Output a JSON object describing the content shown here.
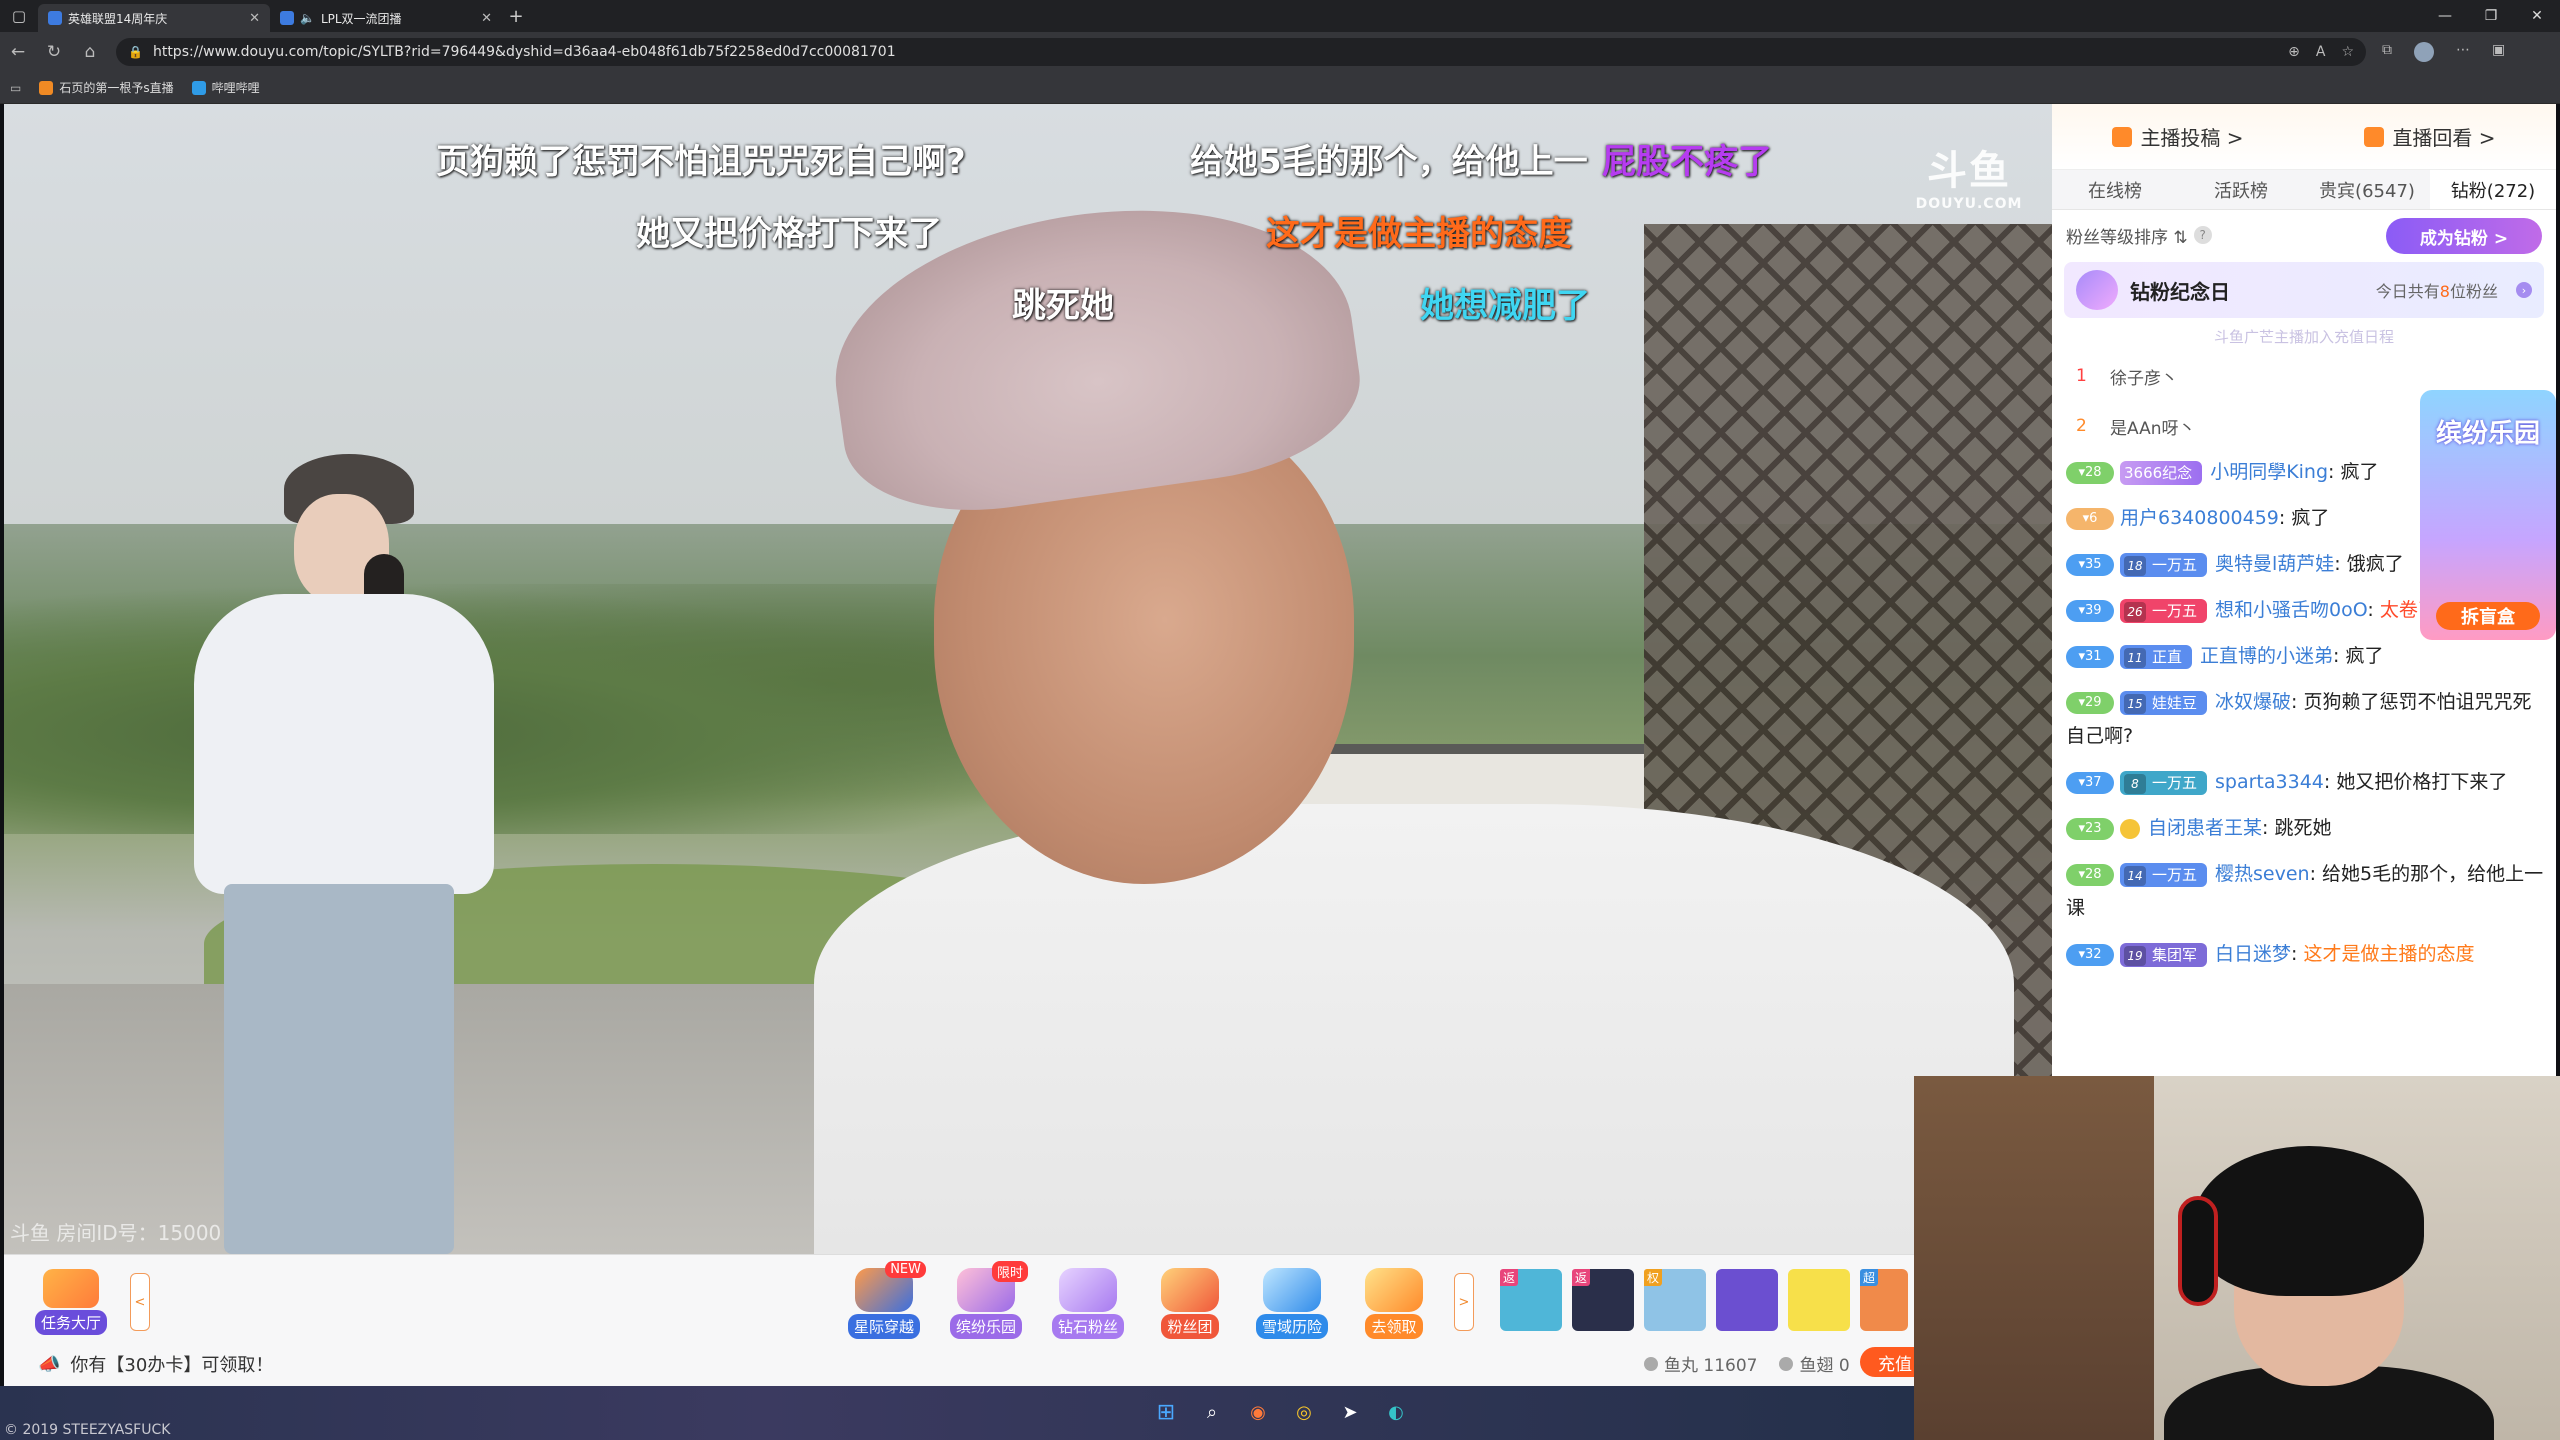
{
  "browser": {
    "tabs": [
      {
        "title": "英雄联盟14周年庆",
        "active": true
      },
      {
        "title": "LPL双一流团播",
        "active": false
      }
    ],
    "url": "https://www.douyu.com/topic/SYLTB?rid=796449&dyshid=d36aa4-eb048f61db75f2258ed0d7cc00081701",
    "bookmarks": [
      "石页的第一根予s直播",
      "哔哩哔哩"
    ]
  },
  "video": {
    "watermark_main": "斗鱼",
    "watermark_sub": "DOUYU.COM",
    "room_number": "斗鱼 房间ID号：15000",
    "danmu": [
      {
        "text": "页狗赖了惩罚不怕诅咒咒死自己啊?",
        "color": "w"
      },
      {
        "text": "给她5毛的那个，给他上一",
        "color": "w"
      },
      {
        "text": "屁股不疼了",
        "color": "p"
      },
      {
        "text": "她又把价格打下来了",
        "color": "w"
      },
      {
        "text": "这才是做主播的态度",
        "color": "o"
      },
      {
        "text": "跳死她",
        "color": "w"
      },
      {
        "text": "她想减肥了",
        "color": "c"
      }
    ]
  },
  "giftbar": {
    "task_hall": "任务大厅",
    "collapse_symbol": "<",
    "expand_symbol": ">",
    "gifts": [
      {
        "label": "星际穿越",
        "badge": "NEW",
        "color": "#3a6fe0"
      },
      {
        "label": "缤纷乐园",
        "badge": "限时",
        "color": "#9b6be8"
      },
      {
        "label": "钻石粉丝",
        "badge": "",
        "color": "#a77af0"
      },
      {
        "label": "粉丝团",
        "badge": "",
        "color": "#f0573a"
      },
      {
        "label": "雪域历险",
        "badge": "",
        "color": "#2f8bea"
      },
      {
        "label": "去领取",
        "badge": "",
        "color": "#ff8a2a"
      }
    ],
    "props": [
      {
        "tag": "返",
        "color": "#4fb6d8"
      },
      {
        "tag": "返",
        "color": "#2a2f4a"
      },
      {
        "tag": "权",
        "color": "#8fc3e6"
      },
      {
        "tag": "",
        "color": "#6b4fd0"
      },
      {
        "tag": "",
        "color": "#f7e04a"
      },
      {
        "tag": "超",
        "color": "#f08a4a"
      }
    ],
    "notice": "你有【30办卡】可领取！",
    "wallet": [
      {
        "label": "鱼丸 11607"
      },
      {
        "label": "鱼翅 0"
      }
    ],
    "recharge": "充值"
  },
  "sidebar": {
    "top_links": [
      "主播投稿 >",
      "直播回看 >"
    ],
    "tabs": [
      {
        "label": "在线榜",
        "active": false
      },
      {
        "label": "活跃榜",
        "active": false
      },
      {
        "label": "贵宾(6547)",
        "active": false
      },
      {
        "label": "钻粉(272)",
        "active": true
      }
    ],
    "sort_label": "粉丝等级排序 ⇅",
    "help": "?",
    "become_diamond": "成为钻粉 >",
    "anniversary": {
      "title": "钻粉纪念日",
      "note_prefix": "今日共有",
      "note_count": "8",
      "note_suffix": "位粉丝",
      "sub": "斗鱼广芒主播加入充值日程"
    },
    "ranks": [
      {
        "no": "1",
        "name": "徐子彦丶"
      },
      {
        "no": "2",
        "name": "是AAn呀丶"
      }
    ],
    "promo": {
      "title": "缤纷乐园",
      "button": "拆盲盒"
    },
    "messages": [
      {
        "lv": "28",
        "lvc": "green",
        "fan_lv": "",
        "fan": "3666纪念",
        "fanc": "fan-special",
        "user": "小明同學King",
        "text": "疯了",
        "tc": ""
      },
      {
        "lv": "6",
        "lvc": "orange",
        "fan_lv": "",
        "fan": "",
        "fanc": "",
        "user": "用户6340800459",
        "text": "疯了",
        "tc": ""
      },
      {
        "lv": "35",
        "lvc": "blue",
        "fan_lv": "18",
        "fan": "一万五",
        "fanc": "fan-blue",
        "user": "奥特曼l葫芦娃",
        "text": "饿疯了",
        "tc": ""
      },
      {
        "lv": "39",
        "lvc": "blue",
        "fan_lv": "26",
        "fan": "一万五",
        "fanc": "fan-red",
        "user": "想和小骚舌吻0oO",
        "text": "太卷了太卷了",
        "tc": "red"
      },
      {
        "lv": "31",
        "lvc": "blue",
        "fan_lv": "11",
        "fan": "正直",
        "fanc": "fan-blue",
        "user": "正直博的小迷弟",
        "text": "疯了",
        "tc": ""
      },
      {
        "lv": "29",
        "lvc": "green",
        "fan_lv": "15",
        "fan": "娃娃豆",
        "fanc": "fan-blue",
        "user": "冰奴爆破",
        "text": "页狗赖了惩罚不怕诅咒咒死自己啊?",
        "tc": ""
      },
      {
        "lv": "37",
        "lvc": "blue",
        "fan_lv": "8",
        "fan": "一万五",
        "fanc": "fan-teal",
        "user": "sparta3344",
        "text": "她又把价格打下来了",
        "tc": ""
      },
      {
        "lv": "23",
        "lvc": "green",
        "fan_lv": "",
        "fan": "",
        "fanc": "",
        "user": "自闭患者王某",
        "text": "跳死她",
        "tc": "",
        "sun": true
      },
      {
        "lv": "28",
        "lvc": "green",
        "fan_lv": "14",
        "fan": "一万五",
        "fanc": "fan-blue",
        "user": "樱热seven",
        "text": "给她5毛的那个，给他上一课",
        "tc": ""
      },
      {
        "lv": "32",
        "lvc": "blue",
        "fan_lv": "19",
        "fan": "集团军",
        "fanc": "fan-purple",
        "user": "白日迷梦",
        "text": "这才是做主播的态度",
        "tc": "orange"
      }
    ]
  },
  "taskbar": {
    "credit": "© 2019 STEEZYASFUCK"
  }
}
